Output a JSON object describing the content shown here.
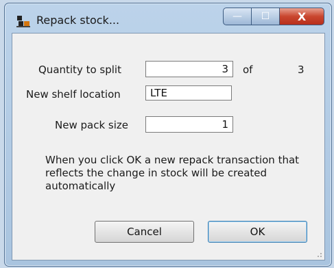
{
  "window": {
    "title": "Repack stock...",
    "icon": "pallet-stack-icon",
    "caption_buttons": {
      "minimize_glyph": "—",
      "maximize_glyph": "☐",
      "close_glyph": "X"
    }
  },
  "form": {
    "quantity_label": "Quantity to split",
    "quantity_value": "3",
    "of_label": "of",
    "of_total": "3",
    "location_label": "New shelf location",
    "location_value": "LTE",
    "pack_size_label": "New pack size",
    "pack_size_value": "1"
  },
  "info_text": "When you click OK a new repack transaction that reflects the change in stock will be created automatically",
  "buttons": {
    "cancel_label": "Cancel",
    "ok_label": "OK"
  },
  "colors": {
    "close_button": "#c9462f",
    "default_button_border": "#3c7fb1"
  }
}
